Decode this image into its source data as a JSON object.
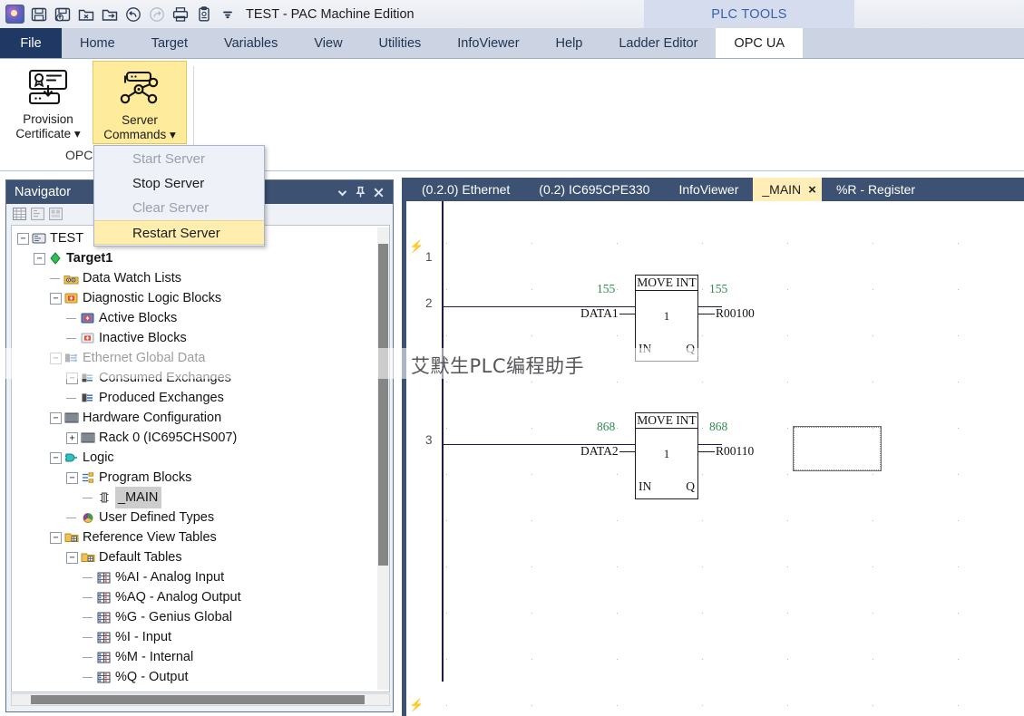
{
  "titlebar": {
    "document_title": "TEST - PAC Machine Edition",
    "quick_access": [
      {
        "name": "app-logo",
        "icon": "app-logo-icon",
        "enabled": true
      },
      {
        "name": "save",
        "icon": "save-icon",
        "enabled": true
      },
      {
        "name": "save-as",
        "icon": "save-as-icon",
        "enabled": true
      },
      {
        "name": "close-project",
        "icon": "folder-close-icon",
        "enabled": true
      },
      {
        "name": "open-project",
        "icon": "folder-open-icon",
        "enabled": true
      },
      {
        "name": "undo",
        "icon": "undo-icon",
        "enabled": true
      },
      {
        "name": "redo",
        "icon": "redo-icon",
        "enabled": false
      },
      {
        "name": "print",
        "icon": "print-icon",
        "enabled": true
      },
      {
        "name": "report",
        "icon": "clipboard-icon",
        "enabled": true
      },
      {
        "name": "customize-quick-access",
        "icon": "chevron-down-icon",
        "enabled": true
      }
    ]
  },
  "ribbon": {
    "contextual_band_label": "PLC TOOLS",
    "tabs": [
      {
        "label": "File",
        "active": false,
        "style": "file"
      },
      {
        "label": "Home",
        "active": false
      },
      {
        "label": "Target",
        "active": false
      },
      {
        "label": "Variables",
        "active": false
      },
      {
        "label": "View",
        "active": false
      },
      {
        "label": "Utilities",
        "active": false
      },
      {
        "label": "InfoViewer",
        "active": false
      },
      {
        "label": "Help",
        "active": false
      },
      {
        "label": "Ladder Editor",
        "active": false
      },
      {
        "label": "OPC UA",
        "active": true
      }
    ],
    "group_label": "OPC",
    "buttons": [
      {
        "label_line1": "Provision",
        "label_line2": "Certificate",
        "icon": "certificate-download-icon",
        "has_dropdown": true,
        "highlighted": false
      },
      {
        "label_line1": "Server",
        "label_line2": "Commands",
        "icon": "server-network-icon",
        "has_dropdown": true,
        "highlighted": true
      }
    ]
  },
  "dropdown_menu": {
    "items": [
      {
        "label": "Start Server",
        "enabled": false,
        "hovered": false
      },
      {
        "label": "Stop Server",
        "enabled": true,
        "hovered": false
      },
      {
        "label": "Clear Server",
        "enabled": false,
        "hovered": false
      },
      {
        "label": "Restart Server",
        "enabled": true,
        "hovered": true
      }
    ]
  },
  "navigator": {
    "title": "Navigator",
    "header_buttons": [
      {
        "name": "panel-menu",
        "icon": "chevron-down-icon"
      },
      {
        "name": "pin-panel",
        "icon": "pin-icon"
      },
      {
        "name": "close-panel",
        "icon": "close-icon"
      }
    ],
    "toolbar_icons": [
      "table-view-icon",
      "properties-icon",
      "inspector-icon"
    ],
    "tree": [
      {
        "label": "TEST",
        "depth": 0,
        "expander": "minus",
        "icon": "project-icon",
        "bold": false,
        "selected": false
      },
      {
        "label": "Target1",
        "depth": 1,
        "expander": "minus",
        "icon": "target-icon",
        "bold": true,
        "selected": false
      },
      {
        "label": "Data Watch Lists",
        "depth": 2,
        "expander": "none",
        "icon": "watchlist-icon",
        "bold": false,
        "selected": false
      },
      {
        "label": "Diagnostic Logic Blocks",
        "depth": 2,
        "expander": "minus",
        "icon": "diagblock-icon",
        "bold": false,
        "selected": false
      },
      {
        "label": "Active Blocks",
        "depth": 3,
        "expander": "none",
        "icon": "activeblock-icon",
        "bold": false,
        "selected": false
      },
      {
        "label": "Inactive Blocks",
        "depth": 3,
        "expander": "none",
        "icon": "inactiveblock-icon",
        "bold": false,
        "selected": false
      },
      {
        "label": "Ethernet Global Data",
        "depth": 2,
        "expander": "minus",
        "icon": "egd-icon",
        "bold": false,
        "selected": false
      },
      {
        "label": "Consumed Exchanges",
        "depth": 3,
        "expander": "minus",
        "icon": "exchange-icon",
        "bold": false,
        "selected": false
      },
      {
        "label": "Produced Exchanges",
        "depth": 3,
        "expander": "none",
        "icon": "exchange-icon",
        "bold": false,
        "selected": false
      },
      {
        "label": "Hardware Configuration",
        "depth": 2,
        "expander": "minus",
        "icon": "rack-icon",
        "bold": false,
        "selected": false
      },
      {
        "label": "Rack 0 (IC695CHS007)",
        "depth": 3,
        "expander": "plus",
        "icon": "rack-icon",
        "bold": false,
        "selected": false
      },
      {
        "label": "Logic",
        "depth": 2,
        "expander": "minus",
        "icon": "logic-icon",
        "bold": false,
        "selected": false
      },
      {
        "label": "Program Blocks",
        "depth": 3,
        "expander": "minus",
        "icon": "progblocks-icon",
        "bold": false,
        "selected": false
      },
      {
        "label": "_MAIN",
        "depth": 4,
        "expander": "none",
        "icon": "block-icon",
        "bold": false,
        "selected": true
      },
      {
        "label": "User Defined Types",
        "depth": 3,
        "expander": "none",
        "icon": "udt-icon",
        "bold": false,
        "selected": false
      },
      {
        "label": "Reference View Tables",
        "depth": 2,
        "expander": "minus",
        "icon": "rvt-icon",
        "bold": false,
        "selected": false
      },
      {
        "label": "Default Tables",
        "depth": 3,
        "expander": "minus",
        "icon": "rvt-icon",
        "bold": false,
        "selected": false
      },
      {
        "label": "%AI - Analog Input",
        "depth": 4,
        "expander": "none",
        "icon": "table-icon",
        "bold": false,
        "selected": false
      },
      {
        "label": "%AQ - Analog Output",
        "depth": 4,
        "expander": "none",
        "icon": "table-icon",
        "bold": false,
        "selected": false
      },
      {
        "label": "%G - Genius Global",
        "depth": 4,
        "expander": "none",
        "icon": "table-icon",
        "bold": false,
        "selected": false
      },
      {
        "label": "%I - Input",
        "depth": 4,
        "expander": "none",
        "icon": "table-icon",
        "bold": false,
        "selected": false
      },
      {
        "label": "%M - Internal",
        "depth": 4,
        "expander": "none",
        "icon": "table-icon",
        "bold": false,
        "selected": false
      },
      {
        "label": "%Q - Output",
        "depth": 4,
        "expander": "none",
        "icon": "table-icon",
        "bold": false,
        "selected": false
      }
    ]
  },
  "editor": {
    "tabs": [
      {
        "label": "(0.2.0) Ethernet",
        "active": false,
        "closable": false
      },
      {
        "label": "(0.2) IC695CPE330",
        "active": false,
        "closable": false
      },
      {
        "label": "InfoViewer",
        "active": false,
        "closable": false
      },
      {
        "label": "_MAIN",
        "active": true,
        "closable": true,
        "close_glyph": "×"
      },
      {
        "label": "%R - Register",
        "active": false,
        "closable": false
      }
    ],
    "watermark": "艾默生PLC编程助手",
    "rungs": [
      {
        "number": "1"
      },
      {
        "number": "2"
      },
      {
        "number": "3"
      }
    ],
    "blocks": [
      {
        "type": "MOVE INT",
        "instance": "1",
        "pin_in": "IN",
        "pin_out": "Q",
        "input_operand": "DATA1",
        "output_operand": "R00100",
        "input_value": "155",
        "output_value": "155",
        "rung": "2"
      },
      {
        "type": "MOVE INT",
        "instance": "1",
        "pin_in": "IN",
        "pin_out": "Q",
        "input_operand": "DATA2",
        "output_operand": "R00110",
        "input_value": "868",
        "output_value": "868",
        "rung": "3"
      }
    ],
    "selection_box": {
      "present": true
    }
  },
  "colors": {
    "accent_panel_header": "#3d5273",
    "ribbon_highlight": "#ffeb9c",
    "menu_hover": "#ffeeae",
    "online_value_green": "#2e8a4e",
    "file_tab_blue": "#1f3864",
    "power_rail": "#1c1c4e"
  }
}
